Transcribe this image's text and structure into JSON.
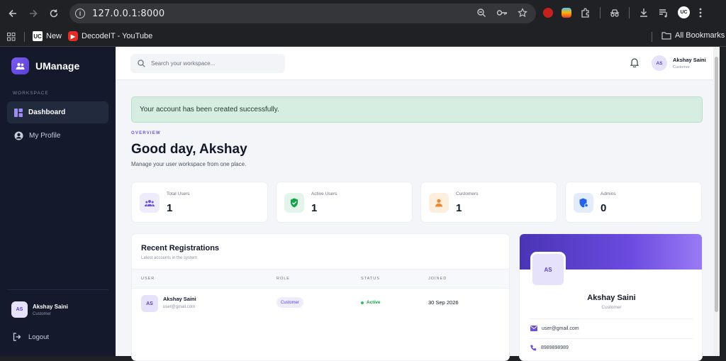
{
  "browser": {
    "url": "127.0.0.1:8000",
    "bookmarks": [
      {
        "label": "New",
        "icon": "uc-icon"
      },
      {
        "label": "DecodeIT - YouTube",
        "icon": "youtube-icon"
      }
    ],
    "all_bookmarks_label": "All Bookmarks",
    "profile_initials": "UC"
  },
  "app": {
    "brand": "UManage",
    "workspace_label": "WORKSPACE",
    "nav": [
      {
        "label": "Dashboard",
        "active": true
      },
      {
        "label": "My Profile",
        "active": false
      }
    ],
    "sidebar_user": {
      "initials": "AS",
      "name": "Akshay Saini",
      "role": "Customer"
    },
    "logout_label": "Logout"
  },
  "topbar": {
    "search_placeholder": "Search your workspace...",
    "user": {
      "initials": "AS",
      "name": "Akshay Saini",
      "role": "Customer"
    }
  },
  "alert": {
    "message": "Your account has been created successfully."
  },
  "overview": {
    "overline": "OVERVIEW",
    "greeting": "Good day, Akshay",
    "subtext": "Manage your user workspace from one place."
  },
  "stats": [
    {
      "label": "Total Users",
      "value": "1",
      "icon": "users-icon",
      "color": "#6d4fe0",
      "bg": "#eeebfb"
    },
    {
      "label": "Active Users",
      "value": "1",
      "icon": "shield-check-icon",
      "color": "#16a34a",
      "bg": "#e3f5ea"
    },
    {
      "label": "Customers",
      "value": "1",
      "icon": "person-icon",
      "color": "#ea8a2f",
      "bg": "#fdeedd"
    },
    {
      "label": "Admins",
      "value": "0",
      "icon": "admin-shield-icon",
      "color": "#2563eb",
      "bg": "#e3ecfb"
    }
  ],
  "registrations": {
    "title": "Recent Registrations",
    "subtitle": "Latest accounts in the system",
    "columns": [
      "USER",
      "ROLE",
      "STATUS",
      "JOINED"
    ],
    "rows": [
      {
        "initials": "AS",
        "name": "Akshay Saini",
        "email": "user@gmail.com",
        "role": "Customer",
        "status": "Active",
        "joined": "30 Sep 2026"
      }
    ]
  },
  "profile": {
    "initials": "AS",
    "name": "Akshay Saini",
    "role": "Customer",
    "email": "user@gmail.com",
    "phone": "8989898989"
  },
  "colors": {
    "accent": "#6d4fe0",
    "sidebar": "#141a2b",
    "success": "#16a34a"
  }
}
